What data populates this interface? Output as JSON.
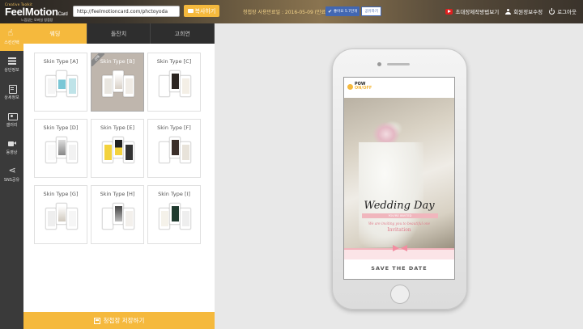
{
  "header": {
    "logo_sub": "Creative Toolkit",
    "logo_main": "FeelMotion",
    "logo_card": "Card",
    "logo_tag": "느낌있는 모바일 청첩장",
    "url_value": "http://feelmotioncard.com/phctoyoda",
    "copy_label": "복사하기",
    "expire_text": "청첩장 사용만료일 : 2016-05-09 (만료 : 1569일 남음)",
    "like_label": "좋아요 5.7만개",
    "share_label": "공유하기",
    "right_links": [
      {
        "label": "초대장제작방법보기",
        "icon": "youtube-icon"
      },
      {
        "label": "회원정보수정",
        "icon": "user-icon"
      },
      {
        "label": "로그아웃",
        "icon": "power-icon"
      }
    ]
  },
  "sidebar": {
    "items": [
      {
        "label": "스킨선택",
        "icon": "hand-pointer-icon",
        "active": true
      },
      {
        "label": "상단정보",
        "icon": "grid-icon"
      },
      {
        "label": "상세정보",
        "icon": "pencil-icon"
      },
      {
        "label": "갤러리",
        "icon": "gallery-icon"
      },
      {
        "label": "동영상",
        "icon": "video-icon"
      },
      {
        "label": "SNS공유",
        "icon": "share-icon"
      }
    ]
  },
  "panel": {
    "tabs": [
      {
        "label": "웨딩",
        "active": true
      },
      {
        "label": "돌잔치",
        "active": false
      },
      {
        "label": "고희연",
        "active": false
      }
    ],
    "skins": [
      {
        "label": "Skin Type [A]"
      },
      {
        "label": "Skin Type [B]",
        "selected": true,
        "badge": "선택"
      },
      {
        "label": "Skin Type [C]"
      },
      {
        "label": "Skin Type [D]"
      },
      {
        "label": "Skin Type [E]"
      },
      {
        "label": "Skin Type [F]"
      },
      {
        "label": "Skin Type [G]"
      },
      {
        "label": "Skin Type [H]"
      },
      {
        "label": "Skin Type [I]"
      }
    ],
    "save_label": "청첩장 저장하기"
  },
  "preview": {
    "brand_top": "POW",
    "brand_onoff": "ON/OFF",
    "title": "Wedding Day",
    "ribbon_text": "YOU'RE INVITED",
    "subtitle": "We are inviting you to beautiful one",
    "invitation": "Invitation",
    "save_date": "SAVE THE DATE"
  },
  "colors": {
    "accent": "#f5b93d",
    "sidebar_bg": "#3a3a3a",
    "tab_bg": "#2e2e2e",
    "facebook": "#4267b2",
    "pink": "#e07a8a"
  }
}
